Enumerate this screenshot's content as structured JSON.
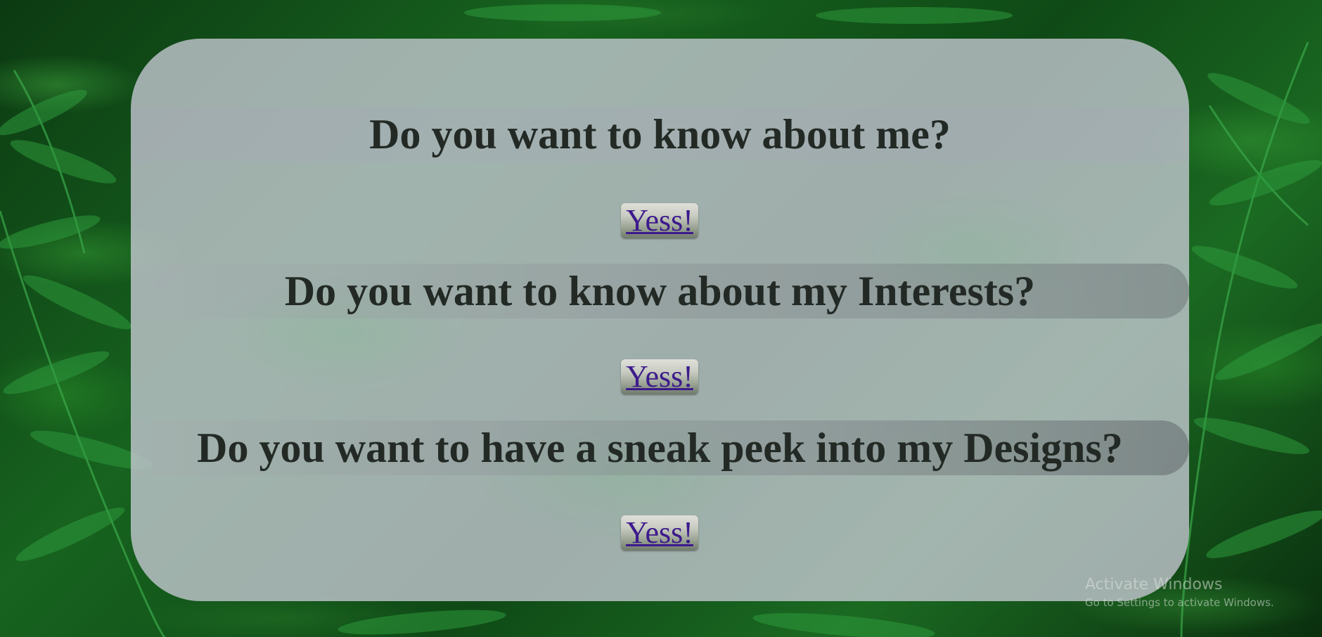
{
  "background": {
    "icon": "fern-leaves-background"
  },
  "sections": [
    {
      "heading": "Do you want to know about me?",
      "button_label": "Yess!"
    },
    {
      "heading": "Do you want to know about my Interests?",
      "button_label": "Yess!"
    },
    {
      "heading": "Do you want to have a sneak peek into my Designs?",
      "button_label": "Yess!"
    }
  ],
  "watermark": {
    "title": "Activate Windows",
    "subtitle": "Go to Settings to activate Windows."
  },
  "colors": {
    "card": "#cdcdda",
    "heading_text": "#232a25",
    "link_text": "#3d1a8c",
    "background_green": "#17631f"
  }
}
